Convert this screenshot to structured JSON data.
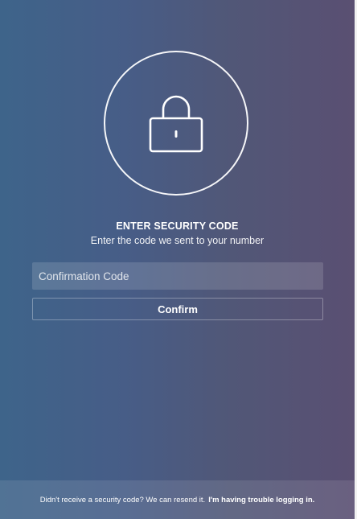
{
  "verify": {
    "icon": "lock-icon",
    "title": "ENTER SECURITY CODE",
    "subtitle": "Enter the code we sent to your number",
    "code_input": {
      "value": "",
      "placeholder": "Confirmation Code"
    },
    "confirm_label": "Confirm"
  },
  "footer": {
    "message": "Didn't receive a security code? We can resend it.",
    "help_link": "I'm having trouble logging in."
  },
  "colors": {
    "gradient_left": "#3e648a",
    "gradient_right": "#5a4f72",
    "text": "#ffffff"
  }
}
